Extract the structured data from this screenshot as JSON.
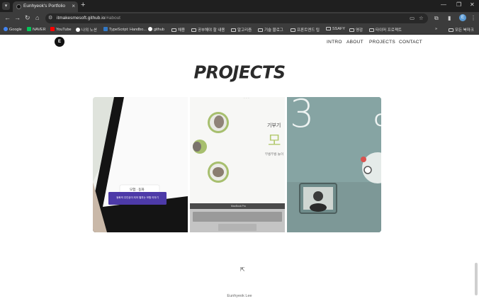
{
  "browser": {
    "tab_title": "Eunhyeok's Portfolio",
    "tab_close": "×",
    "new_tab": "+",
    "tab_menu": "▾",
    "win_minimize": "—",
    "win_maximize": "❐",
    "win_close": "✕",
    "url_host": "itmakesmesoft.github.io",
    "url_path": "/#about",
    "profile_initial": "E"
  },
  "bookmarks": [
    {
      "label": "Google",
      "icon": "google-icon",
      "color": "#4285f4"
    },
    {
      "label": "NAVER",
      "icon": "naver-icon",
      "color": "#03c75a"
    },
    {
      "label": "YouTube",
      "icon": "youtube-icon",
      "color": "#ff0000"
    },
    {
      "label": "나의 노션",
      "icon": "notion-icon",
      "color": "#ffffff"
    },
    {
      "label": "TypeScript: Handbo...",
      "icon": "typescript-icon",
      "color": "#3178c6"
    },
    {
      "label": "github",
      "icon": "github-icon",
      "color": "#ffffff"
    },
    {
      "label": "채용",
      "icon": "folder-icon",
      "color": "#cfcfcf"
    },
    {
      "label": "공부해야 할 내용",
      "icon": "folder-icon",
      "color": "#cfcfcf"
    },
    {
      "label": "알고리즘",
      "icon": "folder-icon",
      "color": "#cfcfcf"
    },
    {
      "label": "기술 블로그",
      "icon": "folder-icon",
      "color": "#cfcfcf"
    },
    {
      "label": "프론트엔드 팁",
      "icon": "folder-icon",
      "color": "#cfcfcf"
    },
    {
      "label": "SSAFY",
      "icon": "folder-icon",
      "color": "#cfcfcf"
    },
    {
      "label": "영감",
      "icon": "folder-icon",
      "color": "#cfcfcf"
    },
    {
      "label": "타이머 프로젝트",
      "icon": "folder-icon",
      "color": "#cfcfcf"
    }
  ],
  "bookmarks_overflow": "»",
  "bookmarks_all": "모든 북마크",
  "site": {
    "logo_text": "E",
    "menu": [
      "INTRO",
      "ABOUT",
      "PROJECTS",
      "CONTACT"
    ],
    "section_title": "PROJECTS",
    "footer": "Eunhyeok Lee"
  },
  "cards": [
    {
      "name": "project-card-1",
      "popup_title": "모험 · 동화",
      "popup_text": "동화의 주인공이 되어 펼치는 모험 이야기"
    },
    {
      "name": "project-card-2",
      "nav_hint": "· · ·",
      "heading": "기부기",
      "big_char": "모",
      "sub": "부릉부릉 놀이",
      "laptop_label": "MacBook Pro"
    },
    {
      "name": "project-card-3",
      "big_digit": "3",
      "ring_char": "C"
    }
  ]
}
